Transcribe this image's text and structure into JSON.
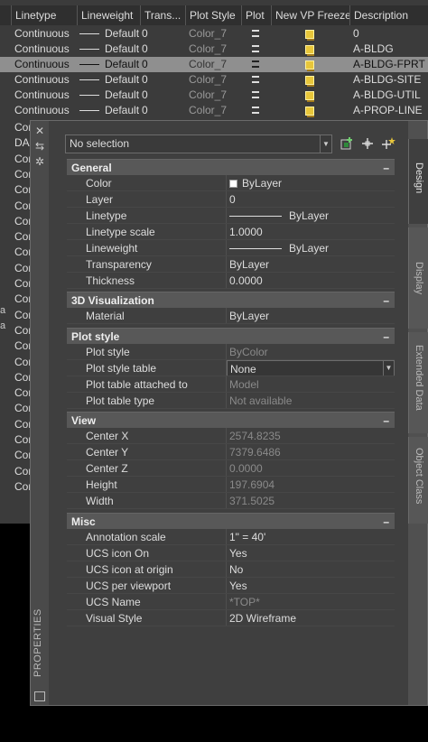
{
  "layer_manager": {
    "columns": [
      "Linetype",
      "Lineweight",
      "Trans...",
      "Plot Style",
      "Plot",
      "New VP Freeze",
      "Description"
    ],
    "rows": [
      {
        "linetype": "Continuous",
        "lineweight": "Default",
        "trans": "0",
        "plot_style": "",
        "description": "0"
      },
      {
        "linetype": "Continuous",
        "lineweight": "Default",
        "trans": "0",
        "plot_style": "Color_7",
        "description": "A-BLDG"
      },
      {
        "linetype": "Continuous",
        "lineweight": "Default",
        "trans": "0",
        "plot_style": "Color_7",
        "description": "A-BLDG-FPRT"
      },
      {
        "linetype": "Continuous",
        "lineweight": "Default",
        "trans": "0",
        "plot_style": "Color_7",
        "description": "A-BLDG-SITE"
      },
      {
        "linetype": "Continuous",
        "lineweight": "Default",
        "trans": "0",
        "plot_style": "Color_7",
        "description": "A-BLDG-UTIL"
      },
      {
        "linetype": "Continuous",
        "lineweight": "Default",
        "trans": "0",
        "plot_style": "Color_7",
        "description": "A-PROP-LINE"
      }
    ],
    "first_row_plot_style": "Color_7",
    "selected_row": 2,
    "truncated_rows": [
      "Con",
      "DA",
      "Con",
      "Con",
      "Con",
      "Con",
      "Con",
      "Con",
      "Con",
      "Con",
      "Con",
      "Con",
      "Con",
      "Con",
      "Con",
      "Con",
      "Con",
      "Con",
      "Con",
      "Con",
      "Con",
      "Con",
      "Con",
      "Con"
    ],
    "stray_chars": [
      "a",
      "a"
    ]
  },
  "palette": {
    "title": "PROPERTIES",
    "selection": "No selection",
    "tabs": [
      "Design",
      "Display",
      "Extended Data",
      "Object Class"
    ],
    "sections": [
      {
        "title": "General",
        "rows": [
          {
            "label": "Color",
            "value": "ByLayer",
            "kind": "color"
          },
          {
            "label": "Layer",
            "value": "0"
          },
          {
            "label": "Linetype",
            "value": "ByLayer",
            "kind": "line"
          },
          {
            "label": "Linetype scale",
            "value": "1.0000"
          },
          {
            "label": "Lineweight",
            "value": "ByLayer",
            "kind": "line"
          },
          {
            "label": "Transparency",
            "value": "ByLayer"
          },
          {
            "label": "Thickness",
            "value": "0.0000"
          }
        ]
      },
      {
        "title": "3D Visualization",
        "rows": [
          {
            "label": "Material",
            "value": "ByLayer"
          }
        ]
      },
      {
        "title": "Plot style",
        "rows": [
          {
            "label": "Plot style",
            "value": "ByColor",
            "disabled": true
          },
          {
            "label": "Plot style table",
            "value": "None",
            "kind": "combo"
          },
          {
            "label": "Plot table attached to",
            "value": "Model",
            "disabled": true
          },
          {
            "label": "Plot table type",
            "value": "Not available",
            "disabled": true
          }
        ]
      },
      {
        "title": "View",
        "rows": [
          {
            "label": "Center X",
            "value": "2574.8235",
            "disabled": true
          },
          {
            "label": "Center Y",
            "value": "7379.6486",
            "disabled": true
          },
          {
            "label": "Center Z",
            "value": "0.0000",
            "disabled": true
          },
          {
            "label": "Height",
            "value": "197.6904",
            "disabled": true
          },
          {
            "label": "Width",
            "value": "371.5025",
            "disabled": true
          }
        ]
      },
      {
        "title": "Misc",
        "rows": [
          {
            "label": "Annotation scale",
            "value": "1\" = 40'"
          },
          {
            "label": "UCS icon On",
            "value": "Yes"
          },
          {
            "label": "UCS icon at origin",
            "value": "No"
          },
          {
            "label": "UCS per viewport",
            "value": "Yes"
          },
          {
            "label": "UCS Name",
            "value": "*TOP*",
            "disabled": true
          },
          {
            "label": "Visual Style",
            "value": "2D Wireframe"
          }
        ]
      }
    ],
    "collapse_glyph": "–"
  }
}
